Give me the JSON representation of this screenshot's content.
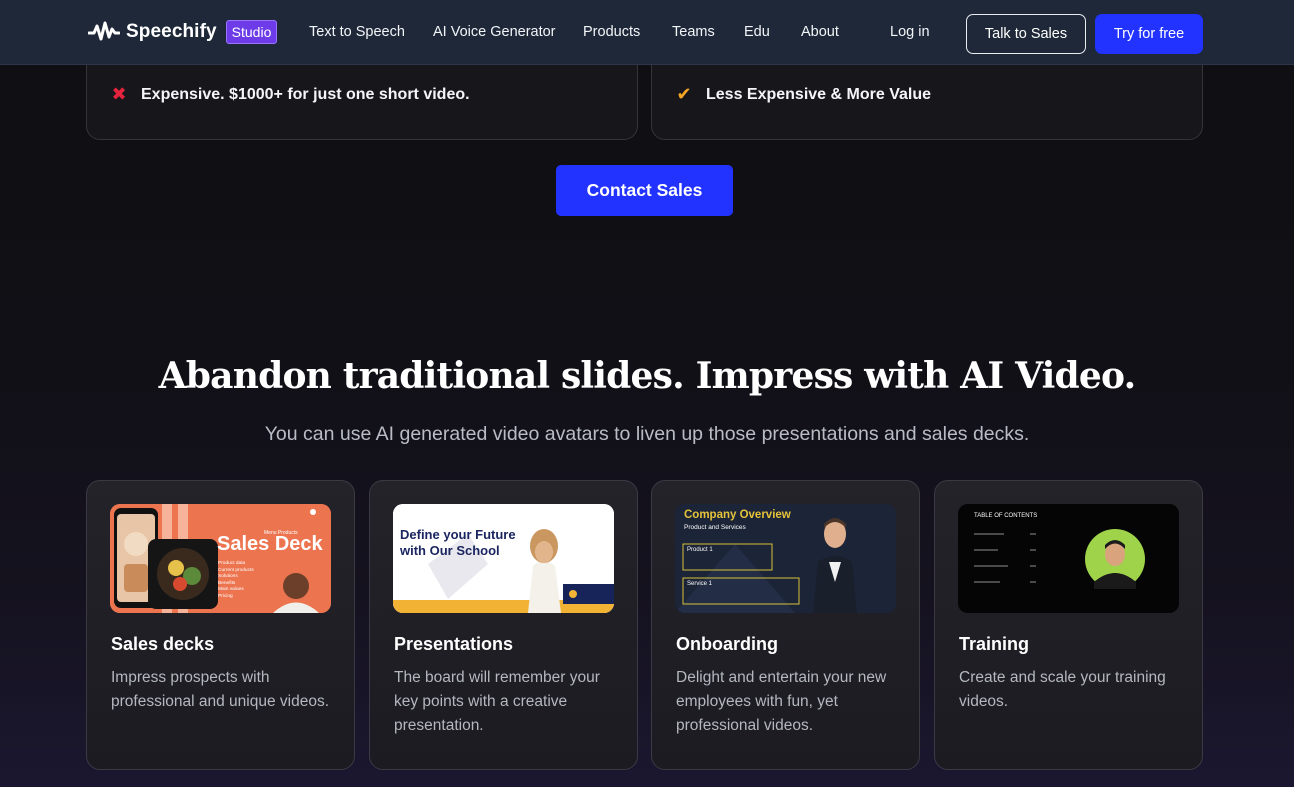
{
  "nav": {
    "brand": "Speechify",
    "badge": "Studio",
    "links": [
      "Text to Speech",
      "AI Voice Generator",
      "Products",
      "Teams",
      "Edu",
      "About"
    ],
    "login": "Log in",
    "talk_to_sales": "Talk to Sales",
    "try_free": "Try for free"
  },
  "comparison": {
    "left_item": "Expensive. $1000+ for just one short video.",
    "right_item": "Less Expensive & More Value",
    "contact_button": "Contact Sales"
  },
  "section": {
    "headline": "Abandon traditional slides. Impress with AI Video.",
    "subheadline": "You can use AI generated video avatars to liven up those presentations and sales decks."
  },
  "cards": [
    {
      "title": "Sales decks",
      "description": "Impress prospects with professional and unique videos.",
      "thumb": {
        "heading": "Sales Deck",
        "tag": "Menu Products",
        "bullets": [
          "Product data",
          "Current products",
          "Solutions",
          "Benefits",
          "Main values",
          "Pricing"
        ]
      }
    },
    {
      "title": "Presentations",
      "description": "The board will remember your key points with a creative presentation.",
      "thumb": {
        "heading": "Define your Future with Our School"
      }
    },
    {
      "title": "Onboarding",
      "description": "Delight and entertain your new employees with fun, yet professional videos.",
      "thumb": {
        "heading": "Company Overview",
        "subheading": "Product and Services",
        "box1": "Product 1",
        "box2": "Service 1"
      }
    },
    {
      "title": "Training",
      "description": "Create and scale your training videos.",
      "thumb": {
        "heading": "TABLE OF CONTENTS"
      }
    }
  ],
  "colors": {
    "accent_blue": "#2233ff",
    "studio_purple": "#6d3ce8",
    "x_red": "#e5233d",
    "check_orange": "#f5a623"
  }
}
